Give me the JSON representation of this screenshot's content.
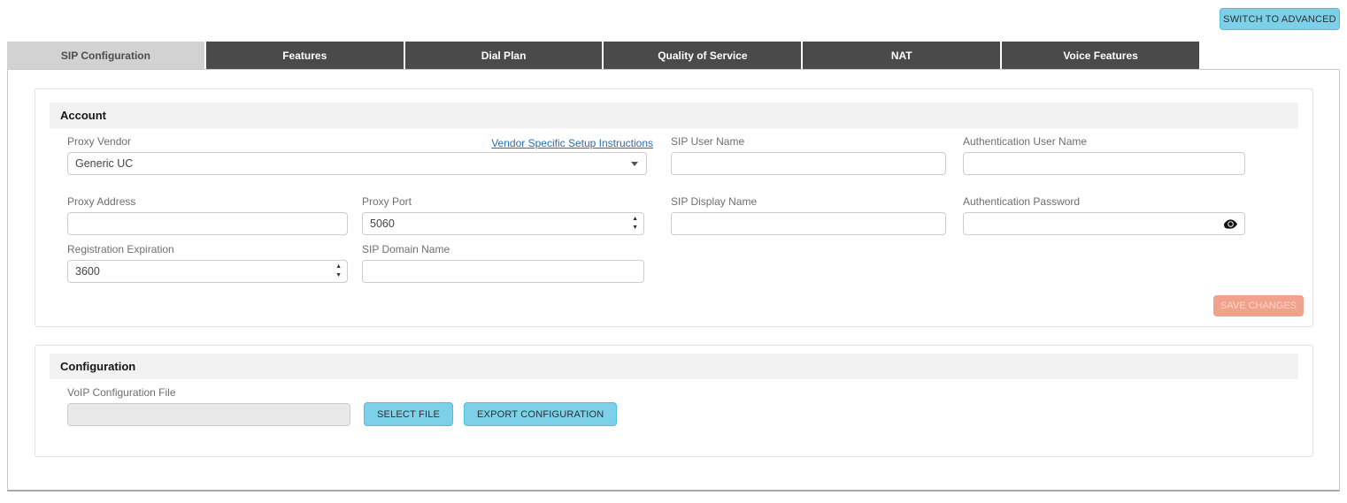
{
  "header": {
    "switch_to_advanced_label": "SWITCH TO ADVANCED"
  },
  "tabs": [
    {
      "label": "SIP Configuration",
      "active": true
    },
    {
      "label": "Features",
      "active": false
    },
    {
      "label": "Dial Plan",
      "active": false
    },
    {
      "label": "Quality of Service",
      "active": false
    },
    {
      "label": "NAT",
      "active": false
    },
    {
      "label": "Voice Features",
      "active": false
    }
  ],
  "account": {
    "title": "Account",
    "vendor_link": "Vendor Specific Setup Instructions",
    "fields": {
      "proxy_vendor": {
        "label": "Proxy Vendor",
        "value": "Generic UC"
      },
      "sip_user_name": {
        "label": "SIP User Name",
        "value": ""
      },
      "auth_user_name": {
        "label": "Authentication User Name",
        "value": ""
      },
      "proxy_address": {
        "label": "Proxy Address",
        "value": ""
      },
      "proxy_port": {
        "label": "Proxy Port",
        "value": "5060"
      },
      "sip_display_name": {
        "label": "SIP Display Name",
        "value": ""
      },
      "auth_password": {
        "label": "Authentication Password",
        "value": ""
      },
      "registration_expiration": {
        "label": "Registration Expiration",
        "value": "3600"
      },
      "sip_domain_name": {
        "label": "SIP Domain Name",
        "value": ""
      }
    },
    "save_button_label": "SAVE CHANGES"
  },
  "configuration": {
    "title": "Configuration",
    "voip_file": {
      "label": "VoIP Configuration File",
      "value": ""
    },
    "select_file_label": "SELECT FILE",
    "export_label": "EXPORT CONFIGURATION"
  },
  "icons": {
    "password_eye": "eye-icon",
    "select_caret": "chevron-down-icon",
    "number_spinner_up": "spinner-up-icon",
    "number_spinner_down": "spinner-down-icon"
  },
  "colors": {
    "accent_cyan": "#7CD1E8",
    "accent_cyan_border": "#4CC0E0",
    "tab_inactive_bg": "#4A4A4A",
    "tab_active_bg": "#D2D2D2",
    "save_disabled_bg": "#F0A28C",
    "save_disabled_text": "#FAD4C7",
    "section_header_bg": "#F2F2F2",
    "link_blue": "#2B6CB0",
    "panel_border": "#C9C9C9"
  }
}
